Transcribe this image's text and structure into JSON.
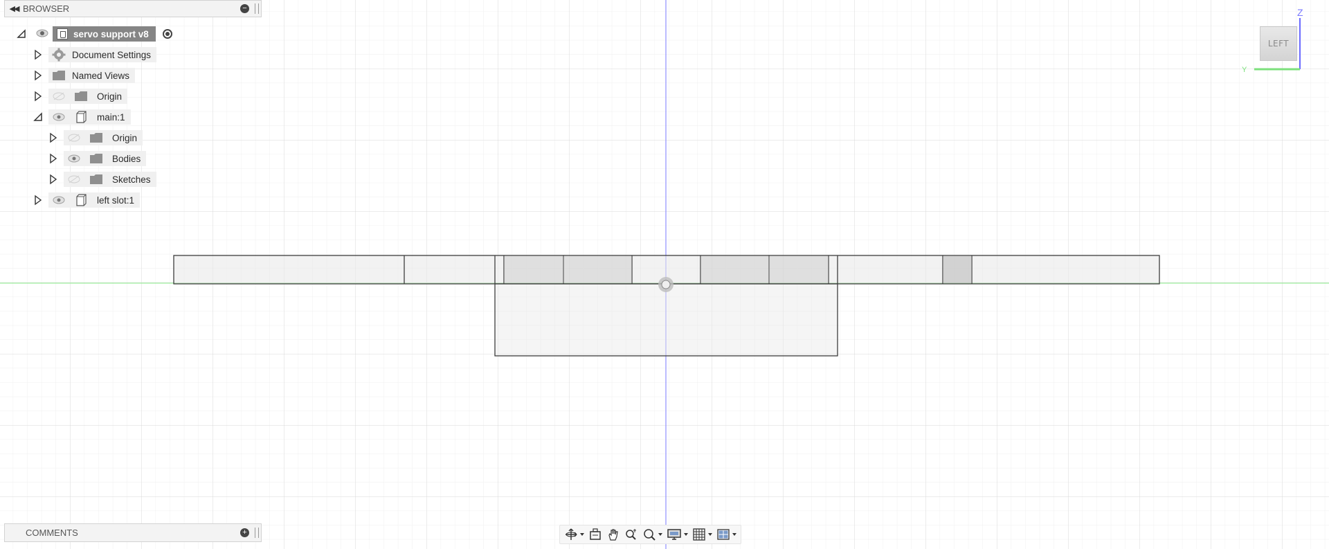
{
  "browser": {
    "title": "BROWSER",
    "root": {
      "label": "servo support v8"
    },
    "items": [
      {
        "label": "Document Settings"
      },
      {
        "label": "Named Views"
      },
      {
        "label": "Origin"
      },
      {
        "label": "main:1"
      },
      {
        "label": "Origin"
      },
      {
        "label": "Bodies"
      },
      {
        "label": "Sketches"
      },
      {
        "label": "left slot:1"
      }
    ]
  },
  "viewcube": {
    "face": "LEFT",
    "z_axis": "Z",
    "y_axis": "Y"
  },
  "comments": {
    "title": "COMMENTS"
  },
  "colors": {
    "x_axis_line": "#8cf08c",
    "z_axis_line": "#6a6aff",
    "grid": "#e2e2e2",
    "root_highlight": "#858585"
  },
  "toolbar": {
    "icons": [
      "orbit-icon",
      "look-at-icon",
      "pan-icon",
      "zoom-icon",
      "fit-icon",
      "display-settings-icon",
      "grid-settings-icon",
      "viewports-icon"
    ]
  }
}
